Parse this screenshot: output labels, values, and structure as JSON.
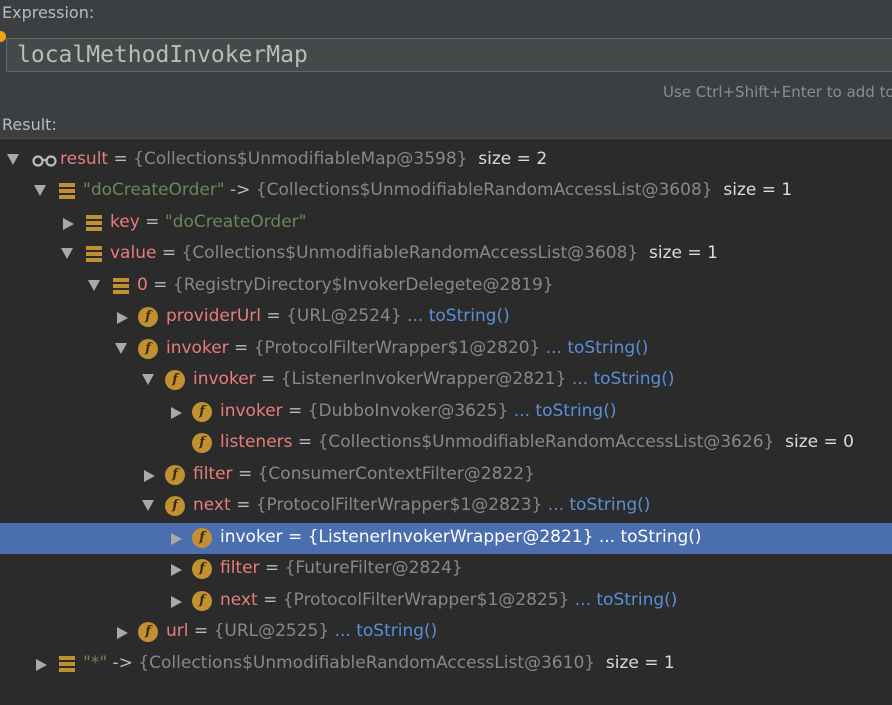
{
  "expression": {
    "label": "Expression:",
    "value": "localMethodInvokerMap",
    "hint": "Use Ctrl+Shift+Enter to add to"
  },
  "result": {
    "label": "Result:"
  },
  "tree": [
    {
      "name": "result",
      "eq": " = ",
      "value": "{Collections$UnmodifiableMap@3598}",
      "size": "size = 2",
      "icon": "glasses",
      "arrow": "down",
      "link": ""
    },
    {
      "name": "\"doCreateOrder\"",
      "eq": " -> ",
      "value": "{Collections$UnmodifiableRandomAccessList@3608}",
      "size": "size = 1",
      "icon": "list",
      "arrow": "down",
      "link": ""
    },
    {
      "name": "key",
      "eq": " = ",
      "value": "\"doCreateOrder\"",
      "size": "",
      "icon": "list",
      "arrow": "right",
      "link": ""
    },
    {
      "name": "value",
      "eq": " = ",
      "value": "{Collections$UnmodifiableRandomAccessList@3608}",
      "size": "size = 1",
      "icon": "list",
      "arrow": "down",
      "link": ""
    },
    {
      "name": "0",
      "eq": " = ",
      "value": "{RegistryDirectory$InvokerDelegete@2819}",
      "size": "",
      "icon": "list",
      "arrow": "down",
      "link": ""
    },
    {
      "name": "providerUrl",
      "eq": " = ",
      "value": "{URL@2524}",
      "size": "",
      "icon": "f",
      "arrow": "right",
      "link": "... toString()"
    },
    {
      "name": "invoker",
      "eq": " = ",
      "value": "{ProtocolFilterWrapper$1@2820}",
      "size": "",
      "icon": "f",
      "arrow": "down",
      "link": "... toString()"
    },
    {
      "name": "invoker",
      "eq": " = ",
      "value": "{ListenerInvokerWrapper@2821}",
      "size": "",
      "icon": "f",
      "arrow": "down",
      "link": "... toString()"
    },
    {
      "name": "invoker",
      "eq": " = ",
      "value": "{DubboInvoker@3625}",
      "size": "",
      "icon": "f",
      "arrow": "right",
      "link": "... toString()"
    },
    {
      "name": "listeners",
      "eq": " = ",
      "value": "{Collections$UnmodifiableRandomAccessList@3626}",
      "size": "size = 0",
      "icon": "f",
      "arrow": "none",
      "link": ""
    },
    {
      "name": "filter",
      "eq": " = ",
      "value": "{ConsumerContextFilter@2822}",
      "size": "",
      "icon": "f",
      "arrow": "right",
      "link": ""
    },
    {
      "name": "next",
      "eq": " = ",
      "value": "{ProtocolFilterWrapper$1@2823}",
      "size": "",
      "icon": "f",
      "arrow": "down",
      "link": "... toString()"
    },
    {
      "name": "invoker",
      "eq": " = ",
      "value": "{ListenerInvokerWrapper@2821}",
      "size": "",
      "icon": "f",
      "arrow": "right",
      "link": "... toString()",
      "selected": true
    },
    {
      "name": "filter",
      "eq": " = ",
      "value": "{FutureFilter@2824}",
      "size": "",
      "icon": "f",
      "arrow": "right",
      "link": ""
    },
    {
      "name": "next",
      "eq": " = ",
      "value": "{ProtocolFilterWrapper$1@2825}",
      "size": "",
      "icon": "f",
      "arrow": "right",
      "link": "... toString()"
    },
    {
      "name": "url",
      "eq": " = ",
      "value": "{URL@2525}",
      "size": "",
      "icon": "f",
      "arrow": "right",
      "link": "... toString()"
    },
    {
      "name": "\"*\"",
      "eq": " -> ",
      "value": "{Collections$UnmodifiableRandomAccessList@3610}",
      "size": "size = 1",
      "icon": "list",
      "arrow": "right",
      "link": ""
    }
  ],
  "colors": {
    "background": "#2b2b2b",
    "selection": "#4b6eaf",
    "field_name": "#e87d7d",
    "string": "#6a8759",
    "link": "#5a8fd6",
    "icon": "#c09033"
  }
}
